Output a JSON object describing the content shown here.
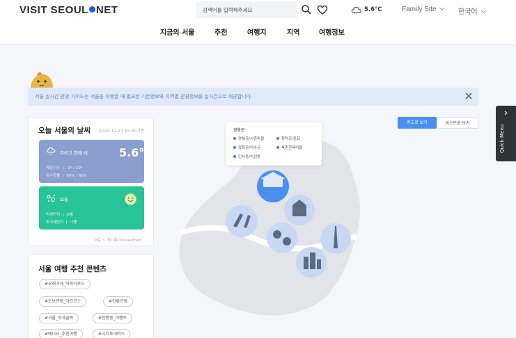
{
  "header": {
    "logo_left": "VISIT SEOUL",
    "logo_right": "NET",
    "search_placeholder": "검색어를 입력해주세요",
    "search_icon": "search-icon",
    "wishlist_icon": "heart-icon",
    "weather_icon": "cloud-icon",
    "temperature": "5.6°C",
    "family_site": "Family Site",
    "language": "한국어"
  },
  "nav": [
    "지금의 서울",
    "추천",
    "여행지",
    "지역",
    "여행정보"
  ],
  "banner": {
    "text": "서울 실시간 관광 가이드는 서울을 여행할 때 필요한 기본정보와 지역별 관광정보를 실시간으로 제공합니다.",
    "close_icon": "close-icon"
  },
  "weather": {
    "title": "오늘 서울의 날씨",
    "datetime": "2023-11-27 15:30기준",
    "condition": "흐리고 한때 비",
    "temperature": "5.6°",
    "feels_label": "체감지수",
    "feels_value": "-3° / 10°",
    "rain_label": "강수확률",
    "rain_value": "60% / 60%",
    "air_status": "보통",
    "fine_dust_label": "미세먼지",
    "fine_dust_value": "보통",
    "ultrafine_label": "초미세먼지",
    "ultrafine_value": "나쁨",
    "source": "자료 > 케이웨더(Kweather)"
  },
  "recommend": {
    "title": "서울 여행 추천 콘텐츠",
    "tags": [
      "#오래가게_덕북이로드",
      "#도보관광_야간코스",
      "#한류관광",
      "#서울_먹자골목",
      "#진행중_이벤트",
      "#에디터_추천여행",
      "#시티투어버스"
    ]
  },
  "map": {
    "map_view": "지도로 보기",
    "list_view": "리스트로 보기",
    "legend_title": "광화문",
    "legend_items": [
      "경복궁/서촌마을",
      "창덕궁/종묘",
      "광화문/덕수궁",
      "북촌한옥마을",
      "인사동/익선동"
    ],
    "accent_color": "#4a8ff0",
    "land_color": "#dfe3e8",
    "river_color": "#ffffff"
  },
  "quick_menu": "Quick Menu"
}
